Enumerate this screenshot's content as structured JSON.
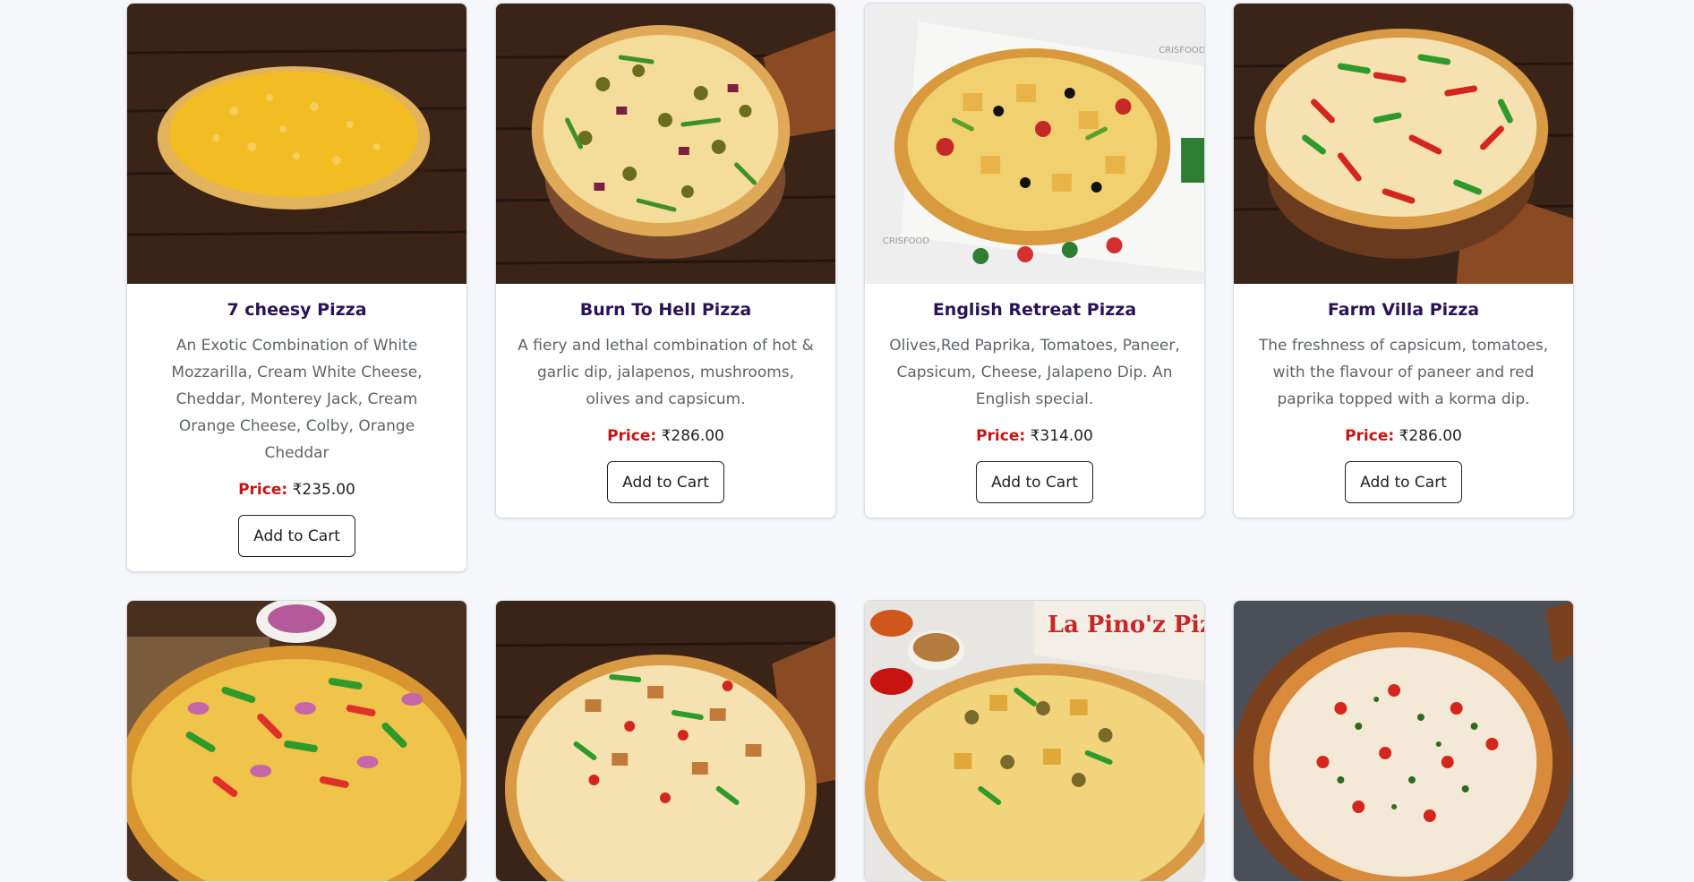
{
  "products": [
    {
      "name": "7 cheesy Pizza",
      "description": "An Exotic Combination of White Mozzarilla, Cream White Cheese, Cheddar, Monterey Jack, Cream Orange Cheese, Colby, Orange Cheddar",
      "price_label": "Price:",
      "price": "₹235.00",
      "button_label": "Add to Cart"
    },
    {
      "name": "Burn To Hell Pizza",
      "description": "A fiery and lethal combination of hot & garlic dip, jalapenos, mushrooms, olives and capsicum.",
      "price_label": "Price:",
      "price": "₹286.00",
      "button_label": "Add to Cart"
    },
    {
      "name": "English Retreat Pizza",
      "description": "Olives,Red Paprika, Tomatoes, Paneer, Capsicum, Cheese, Jalapeno Dip. An English special.",
      "price_label": "Price:",
      "price": "₹314.00",
      "button_label": "Add to Cart"
    },
    {
      "name": "Farm Villa Pizza",
      "description": "The freshness of capsicum, tomatoes, with the flavour of paneer and red paprika topped with a korma dip.",
      "price_label": "Price:",
      "price": "₹286.00",
      "button_label": "Add to Cart"
    }
  ],
  "lower_row": [
    {
      "image": "veggie-pizza-photo"
    },
    {
      "image": "paneer-pizza-photo"
    },
    {
      "image": "boxed-pizza-photo",
      "box_text": "La Pino'z Pizza"
    },
    {
      "image": "margherita-pizza-photo"
    }
  ],
  "image_watermark": "CRISFOOD",
  "colors": {
    "title": "#2a1356",
    "price_label": "#c81313",
    "background": "#f5f7fb"
  }
}
